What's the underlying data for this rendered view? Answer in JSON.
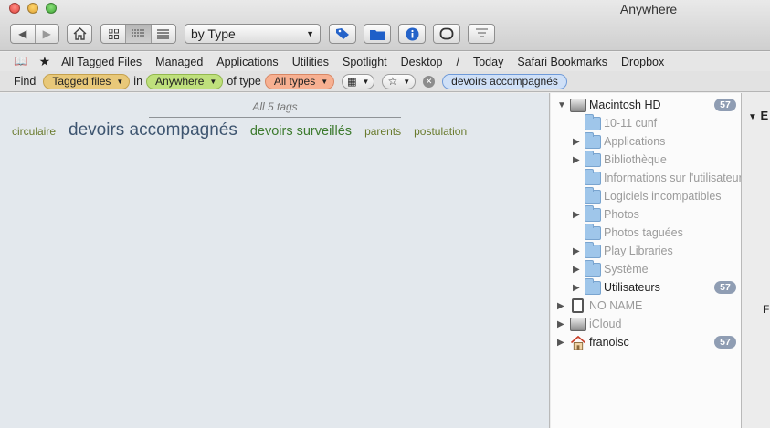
{
  "window": {
    "title": "Anywhere"
  },
  "toolbar": {
    "arrange_popup": "by Type"
  },
  "favorites": [
    "All Tagged Files",
    "Managed",
    "Applications",
    "Utilities",
    "Spotlight",
    "Desktop",
    "/",
    "Today",
    "Safari Bookmarks",
    "Dropbox"
  ],
  "find": {
    "find_label": "Find",
    "kind": "Tagged files",
    "in_label": "in",
    "location": "Anywhere",
    "of_type_label": "of type",
    "types": "All types",
    "tag_token": "devoirs accompagnés"
  },
  "cloud": {
    "header": "All 5 tags",
    "tags": [
      "circulaire",
      "devoirs accompagnés",
      "devoirs surveillés",
      "parents",
      "postulation"
    ]
  },
  "tree": {
    "macintosh_hd": {
      "label": "Macintosh HD",
      "count": "57"
    },
    "children": [
      "10-11 cunf",
      "Applications",
      "Bibliothèque",
      "Informations sur l'utilisateur",
      "Logiciels incompatibles",
      "Photos",
      "Photos taguées",
      "Play Libraries",
      "Système"
    ],
    "users": {
      "label": "Utilisateurs",
      "count": "57"
    },
    "no_name": "NO NAME",
    "icloud": "iCloud",
    "home": {
      "label": "franoisc",
      "count": "57"
    }
  },
  "right_pane": {
    "heading": "E",
    "letter": "F"
  },
  "colors": {
    "pill_kind": "#e8c879",
    "pill_location": "#bfe07c",
    "pill_types": "#f7b091",
    "badge": "#8f9db3",
    "folder": "#9fc6ea",
    "cloud_bg": "#e3e8ed"
  }
}
